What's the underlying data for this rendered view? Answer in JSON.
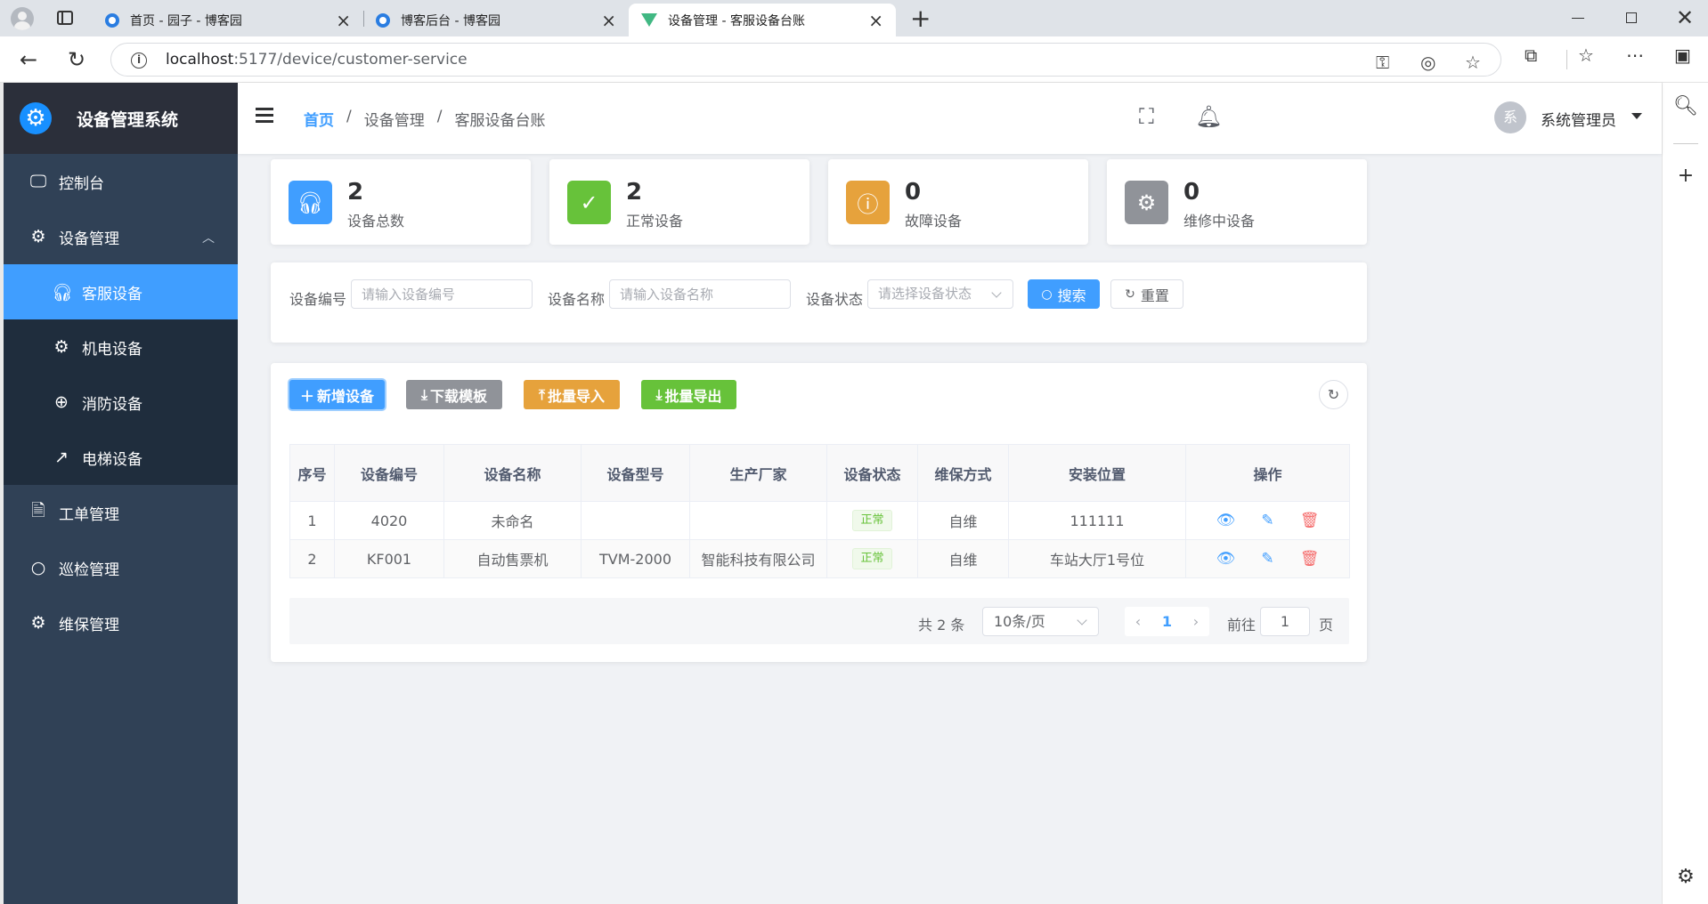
{
  "browser": {
    "tabs": [
      {
        "title": "首页 - 园子 - 博客园",
        "icon": "cnblogs-favicon"
      },
      {
        "title": "博客后台 - 博客园",
        "icon": "cnblogs-favicon"
      },
      {
        "title": "设备管理 - 客服设备台账",
        "icon": "vue-favicon"
      }
    ],
    "url_host": "localhost",
    "url_rest": ":5177/device/customer-service"
  },
  "app": {
    "title": "设备管理系统"
  },
  "sidebar": {
    "items": [
      {
        "label": "控制台",
        "icon": "monitor-icon"
      },
      {
        "label": "设备管理",
        "icon": "gear-icon",
        "expanded": true
      },
      {
        "label": "客服设备",
        "icon": "headset-icon",
        "active": true
      },
      {
        "label": "机电设备",
        "icon": "gear-icon"
      },
      {
        "label": "消防设备",
        "icon": "crosshair-icon"
      },
      {
        "label": "电梯设备",
        "icon": "arrow-up-right-icon"
      },
      {
        "label": "工单管理",
        "icon": "document-icon"
      },
      {
        "label": "巡检管理",
        "icon": "search-icon"
      },
      {
        "label": "维保管理",
        "icon": "cog-filled-icon"
      }
    ]
  },
  "navbar": {
    "breadcrumb": [
      "首页",
      "设备管理",
      "客服设备台账"
    ],
    "avatar_text": "系",
    "user_name": "系统管理员"
  },
  "stats": [
    {
      "value": "2",
      "label": "设备总数",
      "color": "#409eff",
      "icon": "headset-icon"
    },
    {
      "value": "2",
      "label": "正常设备",
      "color": "#67c23a",
      "icon": "check-circle-icon"
    },
    {
      "value": "0",
      "label": "故障设备",
      "color": "#e6a23c",
      "icon": "warning-circle-icon"
    },
    {
      "value": "0",
      "label": "维修中设备",
      "color": "#909399",
      "icon": "cog-filled-icon"
    }
  ],
  "search": {
    "code_label": "设备编号",
    "code_placeholder": "请输入设备编号",
    "name_label": "设备名称",
    "name_placeholder": "请输入设备名称",
    "status_label": "设备状态",
    "status_placeholder": "请选择设备状态",
    "search_button": "搜索",
    "reset_button": "重置"
  },
  "toolbar": {
    "add": "新增设备",
    "template": "下载模板",
    "import": "批量导入",
    "export": "批量导出"
  },
  "table": {
    "columns": [
      "序号",
      "设备编号",
      "设备名称",
      "设备型号",
      "生产厂家",
      "设备状态",
      "维保方式",
      "安装位置",
      "操作"
    ],
    "rows": [
      {
        "index": "1",
        "code": "4020",
        "name": "未命名",
        "model": "",
        "maker": "",
        "status": "正常",
        "maint": "自维",
        "location": "111111"
      },
      {
        "index": "2",
        "code": "KF001",
        "name": "自动售票机",
        "model": "TVM-2000",
        "maker": "智能科技有限公司",
        "status": "正常",
        "maint": "自维",
        "location": "车站大厅1号位"
      }
    ]
  },
  "pagination": {
    "total": "共 2 条",
    "page_size": "10条/页",
    "current": "1",
    "goto_label": "前往",
    "goto_value": "1",
    "page_suffix": "页"
  }
}
